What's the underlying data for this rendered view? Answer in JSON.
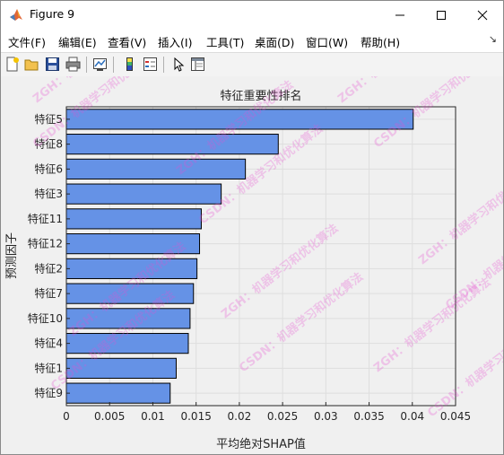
{
  "window": {
    "title": "Figure 9"
  },
  "menubar": [
    {
      "label": "文件(F)"
    },
    {
      "label": "编辑(E)"
    },
    {
      "label": "查看(V)"
    },
    {
      "label": "插入(I)"
    },
    {
      "label": "工具(T)"
    },
    {
      "label": "桌面(D)"
    },
    {
      "label": "窗口(W)"
    },
    {
      "label": "帮助(H)"
    }
  ],
  "toolbar_icons": [
    "new-figure-icon",
    "open-file-icon",
    "save-icon",
    "print-icon",
    "link-plot-icon",
    "insert-colorbar-icon",
    "insert-legend-icon",
    "edit-plot-arrow-icon",
    "property-inspector-icon"
  ],
  "watermark": [
    "ZGH：机器学习和优化算法",
    "CSDN：机器学习和优化算法"
  ],
  "chart_data": {
    "type": "bar",
    "orientation": "horizontal",
    "title": "特征重要性排名",
    "xlabel": "平均绝对SHAP值",
    "ylabel": "预测因子",
    "categories": [
      "特征5",
      "特征8",
      "特征6",
      "特征3",
      "特征11",
      "特征12",
      "特征2",
      "特征7",
      "特征10",
      "特征4",
      "特征1",
      "特征9"
    ],
    "values": [
      0.0401,
      0.0245,
      0.0207,
      0.0179,
      0.0156,
      0.0154,
      0.0151,
      0.0147,
      0.0143,
      0.0141,
      0.0127,
      0.012
    ],
    "xlim": [
      0,
      0.045
    ],
    "xticks": [
      "0",
      "0.005",
      "0.01",
      "0.015",
      "0.02",
      "0.025",
      "0.03",
      "0.035",
      "0.04",
      "0.045"
    ],
    "grid": true,
    "bar_color": "#6592e6"
  }
}
